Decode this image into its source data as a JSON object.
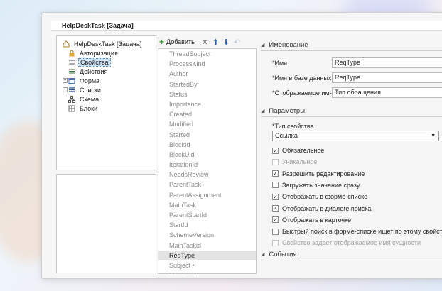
{
  "window": {
    "title": "HelpDeskTask [Задача]"
  },
  "tree": {
    "items": [
      {
        "label": "HelpDeskTask [Задача]",
        "icon": "home-icon"
      },
      {
        "label": "Авторизация",
        "icon": "lock-icon"
      },
      {
        "label": "Свойства",
        "icon": "list-icon"
      },
      {
        "label": "Действия",
        "icon": "actions-icon"
      },
      {
        "label": "Форма",
        "icon": "form-icon"
      },
      {
        "label": "Списки",
        "icon": "lists-icon"
      },
      {
        "label": "Схема",
        "icon": "schema-icon"
      },
      {
        "label": "Блоки",
        "icon": "blocks-icon"
      }
    ]
  },
  "toolbar": {
    "add_label": "Добавить"
  },
  "properties_list": [
    "ThreadSubject",
    "ProcessKind",
    "Author",
    "StartedBy",
    "Status",
    "Importance",
    "Created",
    "Modified",
    "Started",
    "BlockId",
    "BlockUid",
    "IterationId",
    "NeedsReview",
    "ParentTask",
    "ParentAssignment",
    "MainTask",
    "ParentStartId",
    "StartId",
    "SchemeVersion",
    "MainTaskid",
    "ReqType",
    "Subject •",
    "MaxDeadline •"
  ],
  "naming": {
    "header": "Именование",
    "name_label": "*Имя",
    "name_value": "ReqType",
    "db_name_label": "*Имя в базе данных",
    "db_name_value": "ReqType",
    "display_name_label": "*Отображаемое имя",
    "display_name_value": "Тип обращения"
  },
  "params": {
    "header": "Параметры",
    "type_label": "*Тип свойства",
    "type_value": "Ссылка",
    "checkboxes": [
      {
        "label": "Обязательное",
        "checked": "✓"
      },
      {
        "label": "Уникальное",
        "checked": ""
      },
      {
        "label": "Разрешить редактирование",
        "checked": "✓"
      },
      {
        "label": "Загружать значение сразу",
        "checked": ""
      },
      {
        "label": "Отображать в форме-списке",
        "checked": "✓"
      },
      {
        "label": "Отображать в диалоге поиска",
        "checked": "✓"
      },
      {
        "label": "Отображать в карточке",
        "checked": "✓"
      },
      {
        "label": "Быстрый поиск в форме-списке ищет по этому свойству",
        "checked": ""
      },
      {
        "label": "Свойство задает отображаемое имя сущности",
        "checked": ""
      }
    ]
  },
  "events": {
    "header": "События"
  }
}
